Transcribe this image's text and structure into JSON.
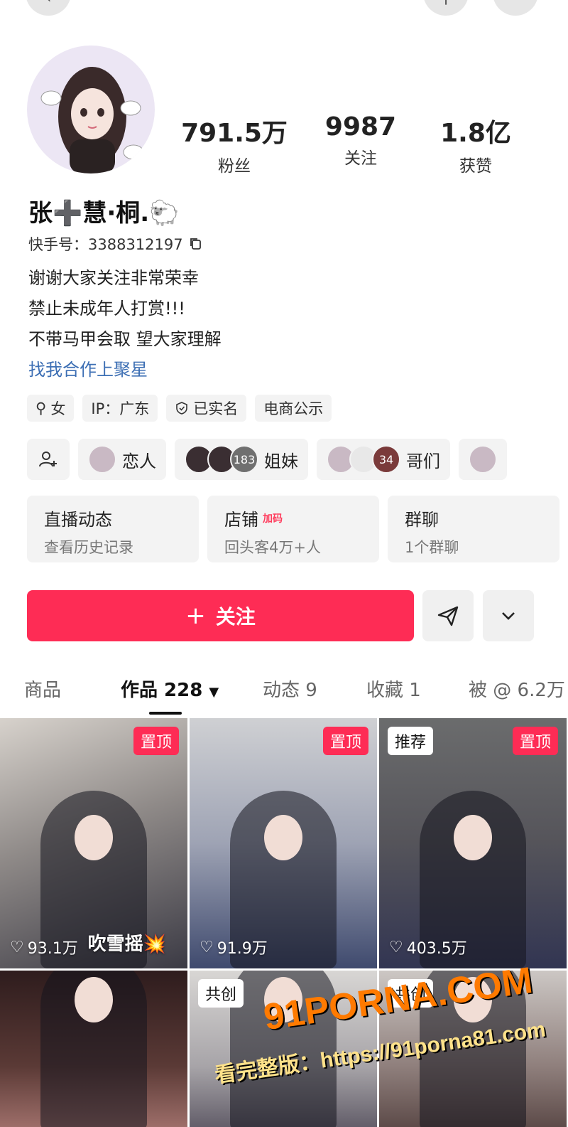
{
  "profile": {
    "name": "张➕慧·桐.🐑",
    "uid_label": "快手号：3388312197",
    "stats": [
      {
        "value": "791.5万",
        "label": "粉丝"
      },
      {
        "value": "9987",
        "label": "关注"
      },
      {
        "value": "1.8亿",
        "label": "获赞"
      }
    ],
    "bio": [
      "谢谢大家关注非常荣幸",
      "禁止未成年人打赏!!!",
      "不带马甲会取 望大家理解"
    ],
    "bio_link": "找我合作上聚星",
    "tags": [
      "女",
      "IP：广东",
      "已实名",
      "电商公示"
    ]
  },
  "relations": {
    "lovers": "恋人",
    "sisters": "姐妹",
    "sisters_count": "183",
    "brothers": "哥们",
    "brothers_count": "34"
  },
  "cards": [
    {
      "title": "直播动态",
      "sub": "查看历史记录",
      "badge": ""
    },
    {
      "title": "店铺",
      "sub": "回头客4万+人",
      "badge": "加码"
    },
    {
      "title": "群聊",
      "sub": "1个群聊",
      "badge": ""
    }
  ],
  "follow_label": "关注",
  "tabs": [
    "商品",
    "作品 228",
    "动态 9",
    "收藏 1",
    "被 @ 6.2万"
  ],
  "posts": [
    {
      "badge": "置顶",
      "likes": "93.1万",
      "overlay": "吹雪摇💥"
    },
    {
      "badge": "置顶",
      "likes": "91.9万"
    },
    {
      "badge_left": "推荐",
      "badge": "置顶",
      "likes": "403.5万"
    },
    {},
    {
      "badge_left": "共创"
    },
    {
      "badge_left": "共创"
    }
  ],
  "watermark": {
    "line1": "91PORNA.COM",
    "line2": "看完整版：https://91porna81.com"
  },
  "colors": {
    "accent": "#fe2c55",
    "link": "#3d6fb4"
  }
}
